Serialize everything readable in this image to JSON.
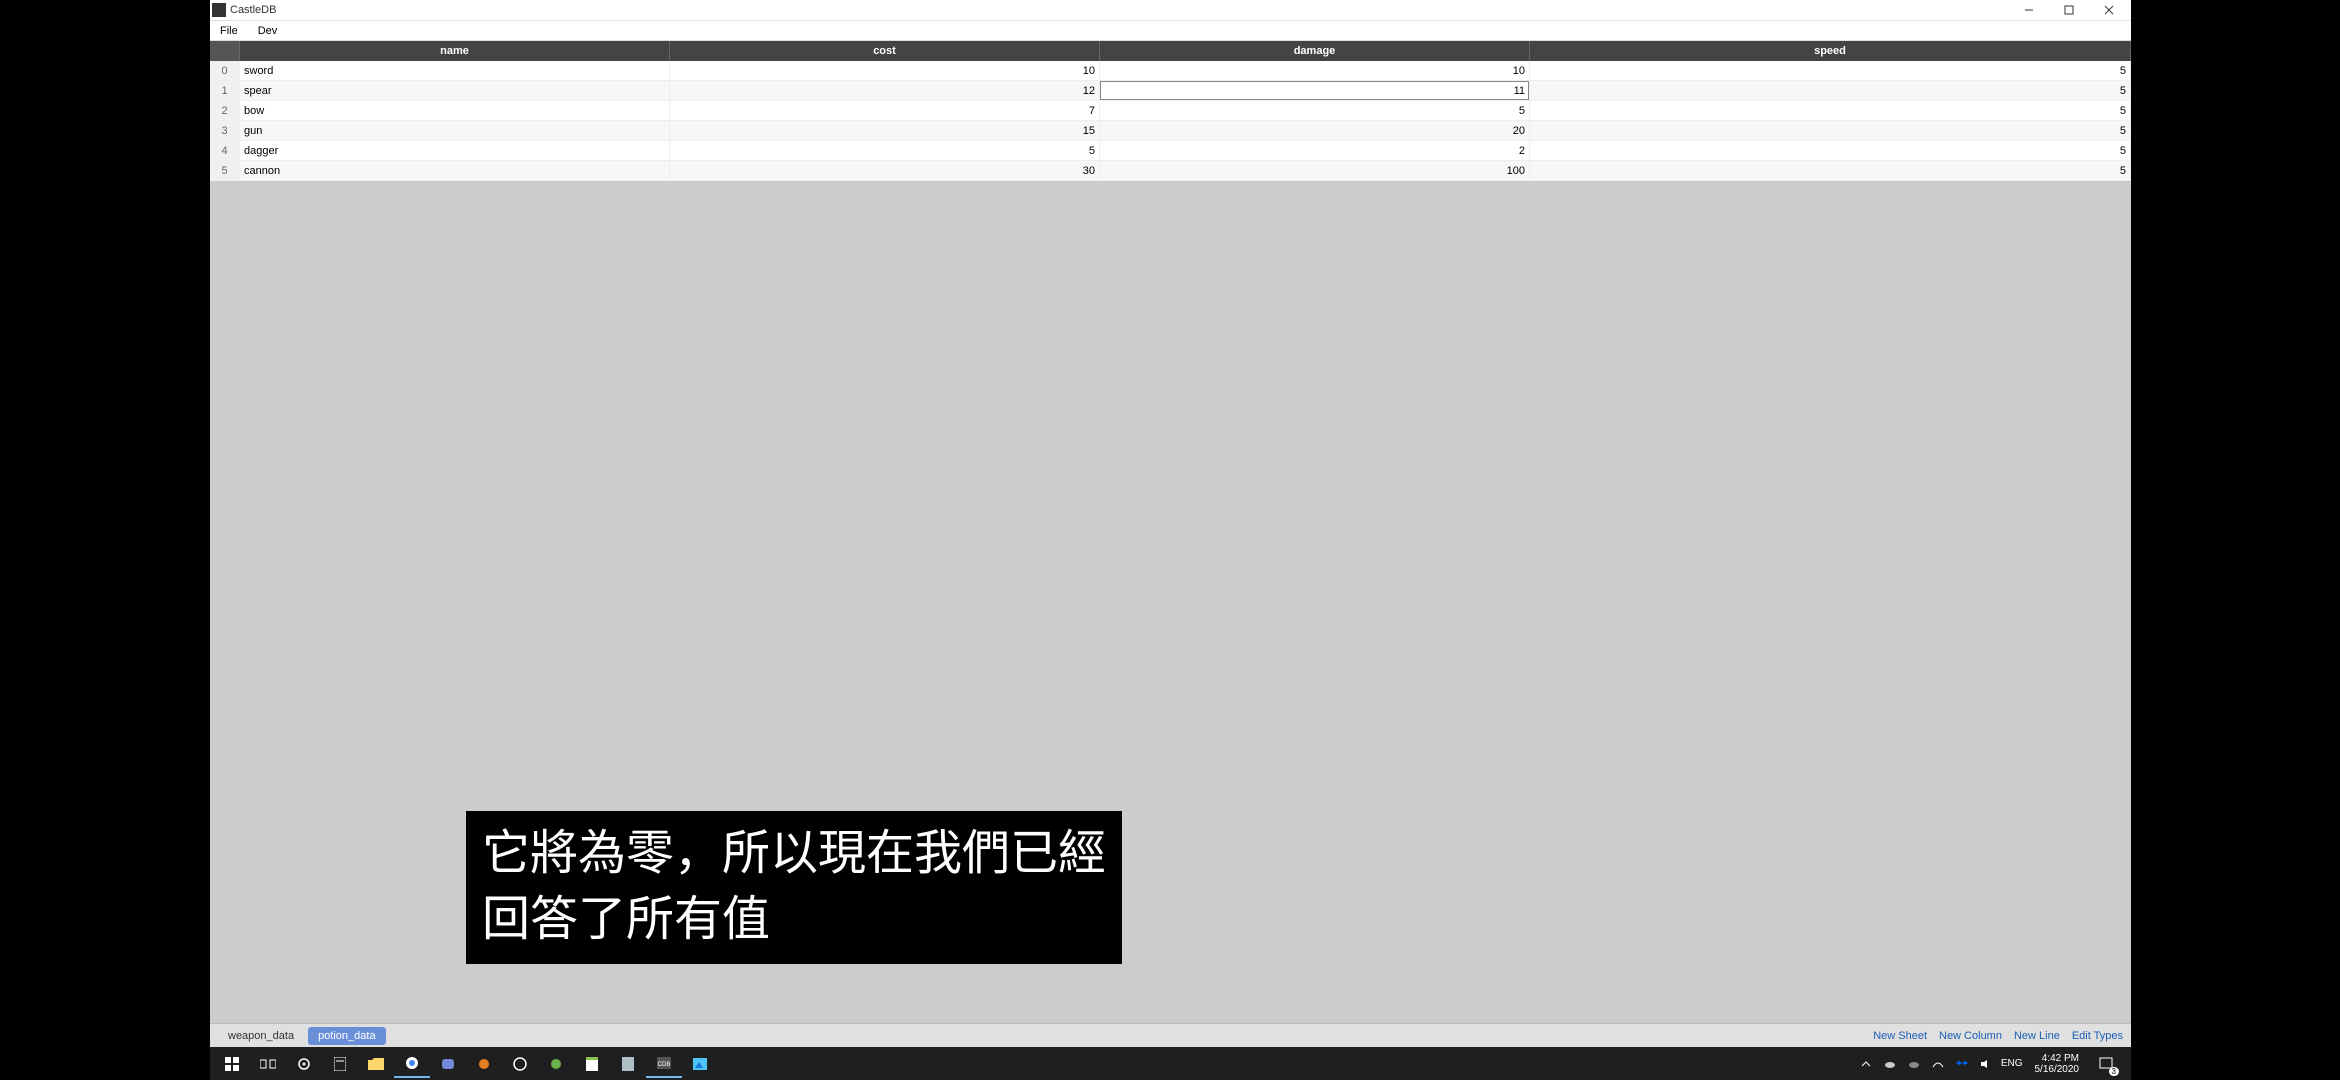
{
  "window": {
    "title": "CastleDB"
  },
  "menu": {
    "file": "File",
    "dev": "Dev"
  },
  "table": {
    "headers": {
      "name": "name",
      "cost": "cost",
      "damage": "damage",
      "speed": "speed"
    },
    "rows": [
      {
        "idx": "0",
        "name": "sword",
        "cost": "10",
        "damage": "10",
        "speed": "5"
      },
      {
        "idx": "1",
        "name": "spear",
        "cost": "12",
        "damage": "11",
        "speed": "5"
      },
      {
        "idx": "2",
        "name": "bow",
        "cost": "7",
        "damage": "5",
        "speed": "5"
      },
      {
        "idx": "3",
        "name": "gun",
        "cost": "15",
        "damage": "20",
        "speed": "5"
      },
      {
        "idx": "4",
        "name": "dagger",
        "cost": "5",
        "damage": "2",
        "speed": "5"
      },
      {
        "idx": "5",
        "name": "cannon",
        "cost": "30",
        "damage": "100",
        "speed": "5"
      }
    ],
    "selected_cell": {
      "row": 1,
      "col": "damage"
    }
  },
  "tabs": {
    "items": [
      {
        "label": "weapon_data",
        "active": false
      },
      {
        "label": "potion_data",
        "active": true
      }
    ]
  },
  "bottom_links": {
    "new_sheet": "New Sheet",
    "new_column": "New Column",
    "new_line": "New Line",
    "edit_types": "Edit Types"
  },
  "subtitle": {
    "line1": "它將為零，所以現在我們已經",
    "line2": "回答了所有值"
  },
  "taskbar": {
    "lang": "ENG",
    "time": "4:42 PM",
    "date": "5/16/2020",
    "notif_count": "3"
  }
}
